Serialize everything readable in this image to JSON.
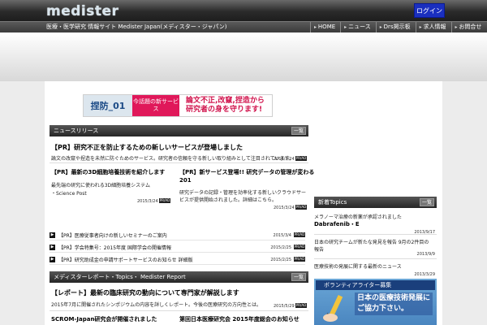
{
  "header": {
    "logo": "medister",
    "login_label": "ログイン",
    "tagline": "医療・医学研究 情報サイト Medister Japan(メディスター・ジャパン)",
    "nav": [
      "HOME",
      "ニュース",
      "Drs掲示板",
      "求人情報",
      "お問合せ"
    ]
  },
  "banner": {
    "brand": "捏防_01",
    "badge": "今話題の新サービス",
    "text_line1": "論文不正,改竄,捏造から",
    "text_line2": "研究者の身を守ります!"
  },
  "news": {
    "header": "ニュースリリース",
    "more_label": "一覧",
    "lead_title": "【PR】研究不正を防止するための新しいサービスが登場しました",
    "lead_excerpt": "論文の改竄や捏造を未然に防ぐためのサービス。研究者の信頼を守る新しい取り組みとして注目されています。",
    "lead_date": "2015/3/24",
    "tag": "PR/AD",
    "col1_title": "【PR】最新の3D細胞培養技術を紹介します",
    "col1_excerpt": "最先端の研究に使われる3D細胞培養システム",
    "col1_source": "・Science Post",
    "col1_date": "2015/3/24",
    "col2_title": "【PR】新サービス登場!! 研究データの管理が変わる",
    "col2_title2": "201",
    "col2_excerpt": "研究データの記録・管理を効率化する新しいクラウドサービスが提供開始されました。詳細はこちら。",
    "col2_date": "2015/3/24",
    "list": [
      {
        "title": "【PR】医療従事者向けの新しいセミナーのご案内",
        "date": "2015/3/4"
      },
      {
        "title": "【PR】学会特集号：2015年度 国際学会の開催情報",
        "date": "2015/2/25"
      },
      {
        "title": "【PR】研究助成金の申請サポートサービスのお知らせ 詳細版",
        "date": "2015/2/25"
      }
    ]
  },
  "report": {
    "header": "メディスターレポート・Topics・ Medister Report",
    "more_label": "一覧",
    "lead_title": "【レポート】最新の臨床研究の動向について専門家が解説します",
    "lead_excerpt": "2015年7月に開催されたシンポジウムの内容を詳しくレポート。今後の医療研究の方向性とは。",
    "lead_date": "2015/5/29",
    "col1_title": "SCROM-Japan研究会が開催されました",
    "col2_title": "第回日本医療研究会 2015年度総会のお知らせ"
  },
  "topics": {
    "header": "新着Topics",
    "more_label": "一覧",
    "items": [
      {
        "title": "メラノーマ治療の新薬が承認されました",
        "title2": "Dabrafenib・E",
        "date": "2013/9/17"
      },
      {
        "title": "日本の研究チームが新たな発見を報告 9月の2件目の",
        "title2": "報告",
        "date": "2013/9/9"
      },
      {
        "title": "医療技術の発展に関する最新のニュース",
        "title2": "",
        "date": "2013/3/29"
      }
    ]
  },
  "volunteer": {
    "header": "ボランティアライター募集",
    "line1": "日本の医療技術発展に",
    "line2": "ご協力下さい。"
  },
  "colors": {
    "login": "#1a2fbf",
    "banner_pink": "#e0185a",
    "volunteer": "#1a3f7c"
  }
}
